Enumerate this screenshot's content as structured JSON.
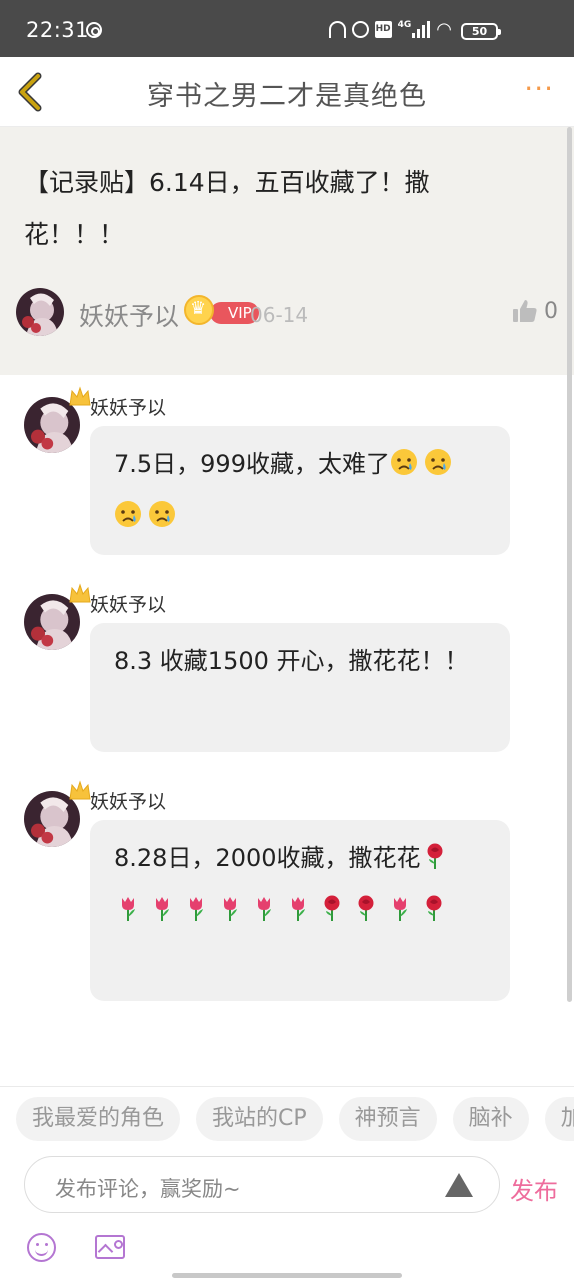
{
  "status_bar": {
    "time": "22:31",
    "network": "4G",
    "hd": "HD",
    "battery": "50"
  },
  "nav": {
    "title": "穿书之男二才是真绝色",
    "more": "···"
  },
  "post": {
    "text": "【记录贴】6.14日，五百收藏了！撒花！！！",
    "author": "妖妖予以",
    "badge": "VIP",
    "date": "06-14",
    "likes": "0"
  },
  "comments": [
    {
      "author": "妖妖予以",
      "text": "7.5日，999收藏，太难了",
      "emojis": [
        "crying-face",
        "crying-face",
        "crying-face",
        "crying-face"
      ]
    },
    {
      "author": "妖妖予以",
      "text": "8.3  收藏1500 开心，撒花花！！",
      "emojis": []
    },
    {
      "author": "妖妖予以",
      "text": "8.28日，2000收藏，撒花花",
      "emojis": [
        "rose",
        "tulip",
        "tulip",
        "tulip",
        "tulip",
        "tulip",
        "tulip",
        "rose",
        "rose",
        "tulip",
        "rose"
      ]
    }
  ],
  "bottom": {
    "chips": [
      "我最爱的角色",
      "我站的CP",
      "神预言",
      "脑补",
      "加"
    ],
    "input_placeholder": "发布评论，赢奖励~",
    "publish": "发布"
  },
  "colors": {
    "accent_pink": "#ee6c9c",
    "nav_more": "#f59a4a",
    "back_arrow": "#c9a20f",
    "vip": "#e9565d",
    "tool_icon": "#b476d2"
  }
}
